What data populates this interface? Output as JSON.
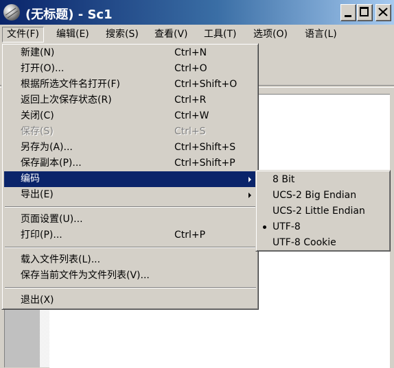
{
  "window": {
    "title": "(无标题) - Sc1"
  },
  "menubar": {
    "items": [
      {
        "label": "文件(F)"
      },
      {
        "label": "编辑(E)"
      },
      {
        "label": "搜索(S)"
      },
      {
        "label": "查看(V)"
      },
      {
        "label": "工具(T)"
      },
      {
        "label": "选项(O)"
      },
      {
        "label": "语言(L)"
      }
    ]
  },
  "file_menu": {
    "items": [
      {
        "label": "新建(N)",
        "shortcut": "Ctrl+N"
      },
      {
        "label": "打开(O)...",
        "shortcut": "Ctrl+O"
      },
      {
        "label": "根据所选文件名打开(F)",
        "shortcut": "Ctrl+Shift+O"
      },
      {
        "label": "返回上次保存状态(R)",
        "shortcut": "Ctrl+R"
      },
      {
        "label": "关闭(C)",
        "shortcut": "Ctrl+W"
      },
      {
        "label": "保存(S)",
        "shortcut": "Ctrl+S",
        "disabled": true
      },
      {
        "label": "另存为(A)...",
        "shortcut": "Ctrl+Shift+S"
      },
      {
        "label": "保存副本(P)...",
        "shortcut": "Ctrl+Shift+P"
      },
      {
        "label": "编码",
        "submenu": true,
        "highlighted": true
      },
      {
        "label": "导出(E)",
        "submenu": true
      },
      {
        "label": "页面设置(U)..."
      },
      {
        "label": "打印(P)...",
        "shortcut": "Ctrl+P"
      },
      {
        "label": "载入文件列表(L)..."
      },
      {
        "label": "保存当前文件为文件列表(V)..."
      },
      {
        "label": "退出(X)"
      }
    ]
  },
  "encoding_menu": {
    "items": [
      {
        "label": "8 Bit",
        "checked": false
      },
      {
        "label": "UCS-2 Big Endian",
        "checked": false
      },
      {
        "label": "UCS-2 Little Endian",
        "checked": false
      },
      {
        "label": "UTF-8",
        "checked": true
      },
      {
        "label": "UTF-8 Cookie",
        "checked": false
      }
    ]
  },
  "colors": {
    "highlight": "#0a246a",
    "title_gradient_start": "#0a246a",
    "title_gradient_end": "#a6caf0",
    "face": "#d4d0c8"
  },
  "icons": {
    "app": "scite-globe-icon",
    "minimize": "minimize-icon",
    "maximize": "maximize-icon",
    "close": "close-icon",
    "submenu": "chevron-right-icon",
    "radio": "radio-dot-icon"
  }
}
